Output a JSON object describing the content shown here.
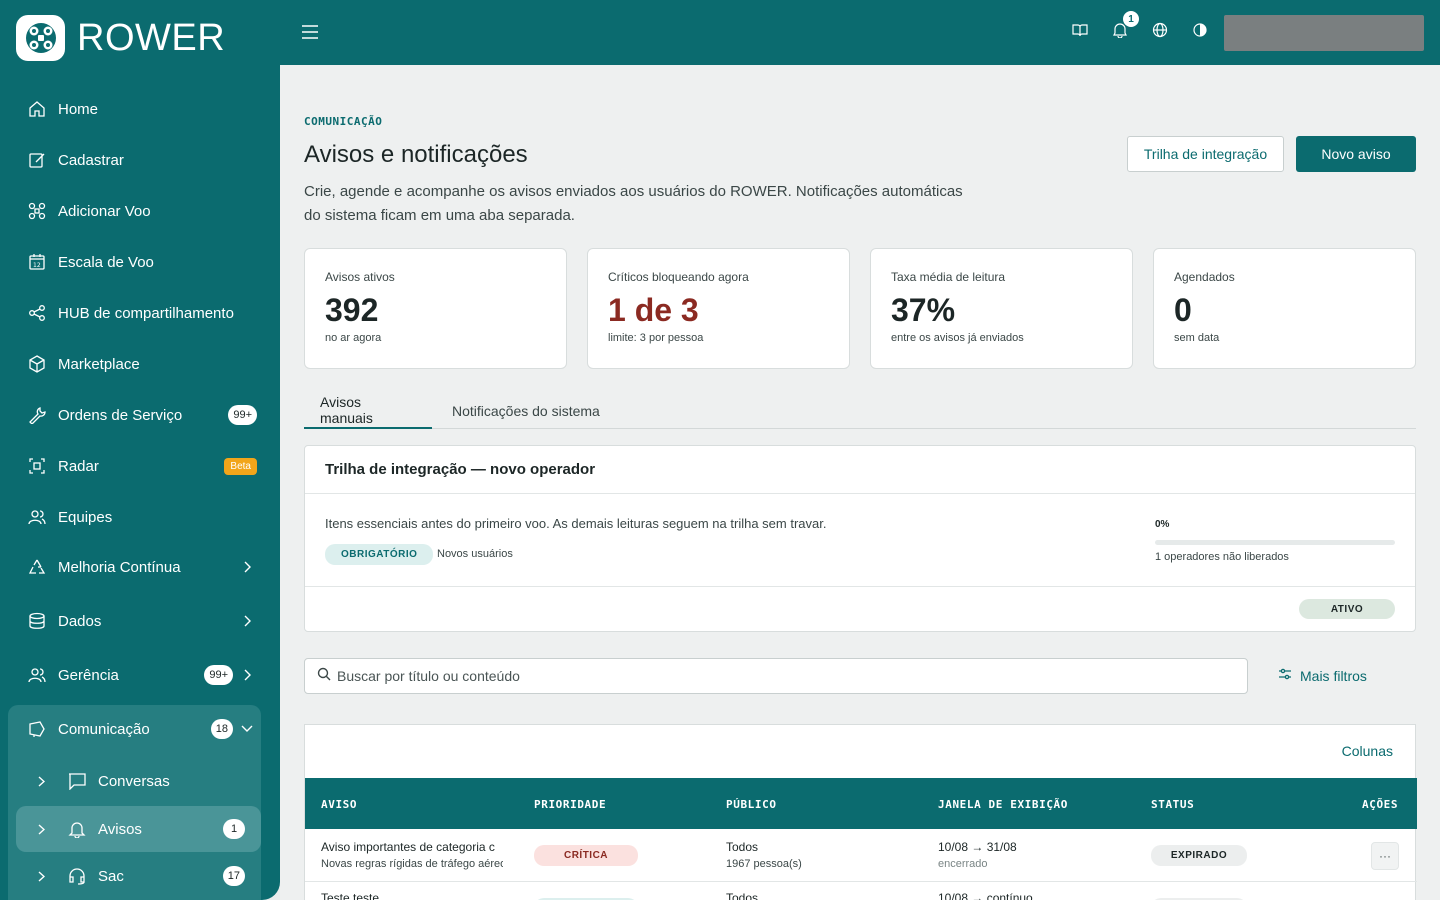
{
  "brand": {
    "name": "ROWER"
  },
  "sidebar": {
    "items": [
      {
        "label": "Home",
        "icon": "home-icon"
      },
      {
        "label": "Cadastrar",
        "icon": "edit-icon"
      },
      {
        "label": "Adicionar Voo",
        "icon": "drone-icon"
      },
      {
        "label": "Escala de Voo",
        "icon": "calendar-icon",
        "icon_text": "12"
      },
      {
        "label": "HUB de compartilhamento",
        "icon": "share-icon"
      },
      {
        "label": "Marketplace",
        "icon": "box-icon"
      },
      {
        "label": "Ordens de Serviço",
        "icon": "wrench-icon",
        "badge": "99+"
      },
      {
        "label": "Radar",
        "icon": "radar-icon",
        "tag": "Beta"
      },
      {
        "label": "Equipes",
        "icon": "users-icon"
      },
      {
        "label": "Melhoria Contínua",
        "icon": "recycle-icon"
      },
      {
        "label": "Dados",
        "icon": "database-icon"
      },
      {
        "label": "Gerência",
        "icon": "team-icon",
        "badge": "99+"
      },
      {
        "label": "Comunicação",
        "icon": "megaphone-icon",
        "badge": "18"
      }
    ],
    "sub_items": [
      {
        "label": "Conversas",
        "icon": "chat-icon"
      },
      {
        "label": "Avisos",
        "icon": "bell-icon",
        "badge": "1"
      },
      {
        "label": "Sac",
        "icon": "headset-icon",
        "badge": "17"
      }
    ]
  },
  "topbar": {
    "notification_count": "1"
  },
  "page": {
    "eyebrow": "COMUNICAÇÃO",
    "title": "Avisos e notificações",
    "description": "Crie, agende e acompanhe os avisos enviados aos usuários do ROWER. Notificações automáticas do sistema ficam em uma aba separada.",
    "btn_trail": "Trilha de integração",
    "btn_new": "Novo aviso"
  },
  "stats": [
    {
      "label": "Avisos ativos",
      "value": "392",
      "sub": "no ar agora"
    },
    {
      "label": "Críticos bloqueando agora",
      "value": "1 de 3",
      "sub": "limite: 3 por pessoa"
    },
    {
      "label": "Taxa média de leitura",
      "value": "37%",
      "sub": "entre os avisos já enviados"
    },
    {
      "label": "Agendados",
      "value": "0",
      "sub": "sem data"
    }
  ],
  "tabs": [
    "Avisos manuais",
    "Notificações do sistema"
  ],
  "onboarding": {
    "title": "Trilha de integração — novo operador",
    "description": "Itens essenciais antes do primeiro voo. As demais leituras seguem na trilha sem travar.",
    "tag": "OBRIGATÓRIO",
    "audience": "Novos usuários",
    "percent": "0%",
    "progress": 0,
    "note": "1 operadores não liberados",
    "status": "ATIVO"
  },
  "search": {
    "placeholder": "Buscar por título ou conteúdo",
    "more_filters": "Mais filtros"
  },
  "table": {
    "columns_link": "Colunas",
    "headers": [
      "AVISO",
      "PRIORIDADE",
      "PÚBLICO",
      "JANELA DE EXIBIÇÃO",
      "STATUS",
      "AÇÕES"
    ],
    "rows": [
      {
        "title": "Aviso importantes de categoria c",
        "subtitle": "Novas regras rígidas de tráfego aéreo",
        "priority": "CRÍTICA",
        "audience": "Todos",
        "audience_count": "1967 pessoa(s)",
        "window": "10/08 → 31/08",
        "window_note": "encerrado",
        "status": "EXPIRADO",
        "action": "···"
      },
      {
        "title": "Teste teste",
        "audience": "Todos",
        "window": "10/08 → contínuo"
      }
    ]
  },
  "colors": {
    "brand": "#0b6b6f",
    "critical": "#8b2a22",
    "beta": "#f2a51a"
  }
}
